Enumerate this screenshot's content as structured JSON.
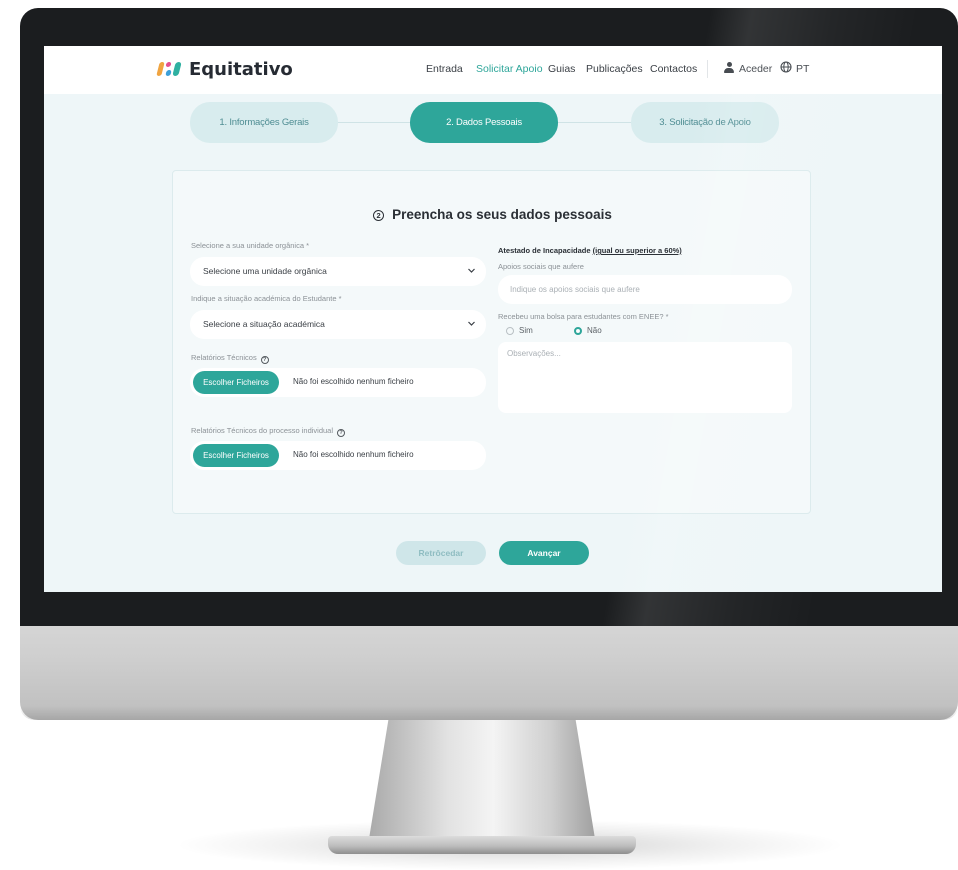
{
  "brand": {
    "name": "Equitativo"
  },
  "nav": {
    "links": [
      "Entrada",
      "Solicitar Apoio",
      "Guias",
      "Publicações",
      "Contactos"
    ],
    "login_label": "Aceder",
    "language": "PT"
  },
  "stepper": {
    "steps": [
      "1. Informações Gerais",
      "2. Dados Pessoais",
      "3. Solicitação de Apoio"
    ],
    "active_index": 1
  },
  "form": {
    "step_number": "2",
    "title": "Preencha os seus dados pessoais",
    "org_unit": {
      "label": "Selecione a sua unidade orgânica *",
      "value": "Selecione uma unidade orgânica"
    },
    "academic_status": {
      "label": "Indique a situação académica do Estudante *",
      "value": "Selecione a situação académica"
    },
    "technical_reports": {
      "label": "Relatórios Técnicos",
      "button": "Escolher Ficheiros",
      "status": "Não foi escolhido nenhum ficheiro"
    },
    "individual_reports": {
      "label": "Relatórios Técnicos do processo individual",
      "button": "Escolher Ficheiros",
      "status": "Não foi escolhido nenhum ficheiro"
    },
    "disability": {
      "label_prefix": "Atestado de Incapacidade",
      "label_underlined": "(igual ou superior a 60%)"
    },
    "social_support": {
      "label": "Apoios sociais que aufere",
      "placeholder": "Indique os apoios sociais que aufere"
    },
    "enee": {
      "label": "Recebeu uma bolsa para estudantes com ENEE? *",
      "options": [
        "Sim",
        "Não"
      ],
      "selected": "Não"
    },
    "notes": {
      "placeholder": "Observações..."
    }
  },
  "actions": {
    "back": "Retrôcedar",
    "next": "Avançar"
  },
  "colors": {
    "accent": "#2ea69a",
    "step_inactive": "#d8ecee",
    "background": "#eef6f8"
  }
}
